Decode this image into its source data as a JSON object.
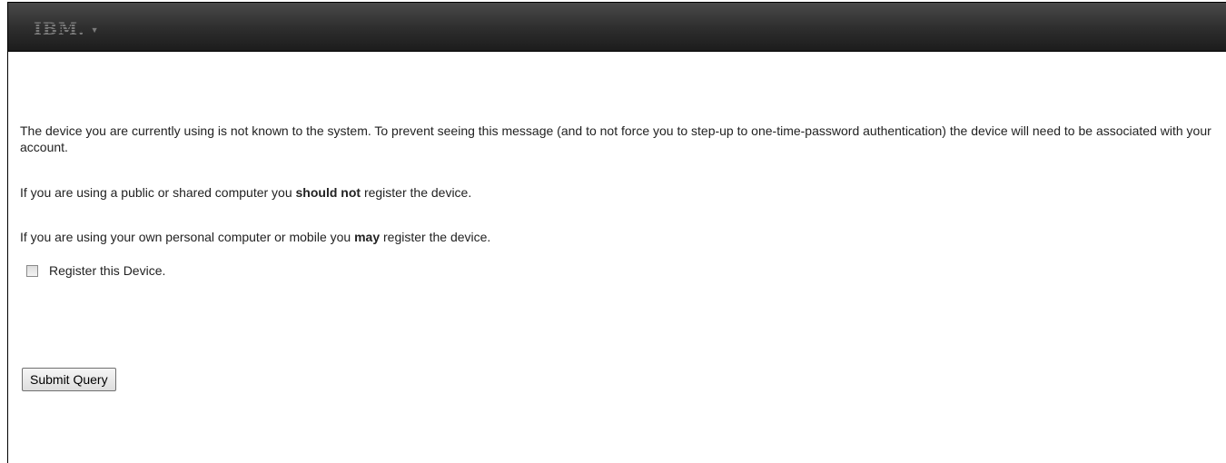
{
  "header": {
    "logo_text": "IBM.",
    "logo_caret": "▼"
  },
  "content": {
    "paragraph1": "The device you are currently using is not known to the system. To prevent seeing this message (and to not force you to step-up to one-time-password authentication) the device will need to be associated with your account.",
    "paragraph2_before": "If you are using a public or shared computer you ",
    "paragraph2_bold": "should not",
    "paragraph2_after": " register the device.",
    "paragraph3_before": "If you are using your own personal computer or mobile you ",
    "paragraph3_bold": "may",
    "paragraph3_after": " register the device."
  },
  "register_checkbox": {
    "label": "Register this Device.",
    "checked": false
  },
  "submit_button": {
    "label": "Submit Query"
  },
  "colors": {
    "topbar": "#2f2f2f",
    "logo": "#7a7a7a",
    "text": "#222222"
  }
}
